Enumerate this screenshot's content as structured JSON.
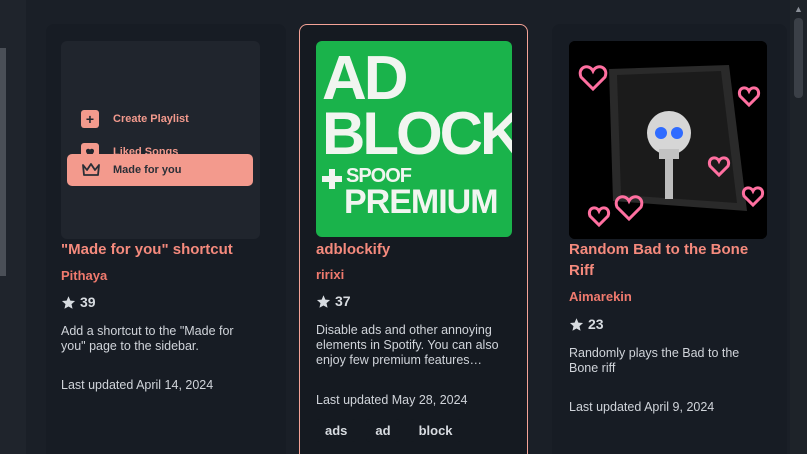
{
  "cards": [
    {
      "title": "\"Made for you\" shortcut",
      "author": "Pithaya",
      "stars": "39",
      "description": "Add a shortcut to the \"Made for you\" page to the sidebar.",
      "updated": "Last updated April 14, 2024",
      "preview": {
        "items": [
          "Create Playlist",
          "Liked Songs",
          "Made for you"
        ]
      }
    },
    {
      "title": "adblockify",
      "author": "ririxi",
      "stars": "37",
      "description": "Disable ads and other annoying elements in Spotify. You can also enjoy few premium features…",
      "updated": "Last updated May 28, 2024",
      "tags": [
        "ads",
        "ad",
        "block"
      ],
      "preview": {
        "line1": "AD",
        "line2": "BLOCK",
        "line3": "SPOOF",
        "line4": "PREMIUM"
      }
    },
    {
      "title": "Random Bad to the Bone Riff",
      "author": "Aimarekin",
      "stars": "23",
      "description": "Randomly plays the Bad to the Bone riff",
      "updated": "Last updated April 9, 2024"
    }
  ],
  "colors": {
    "accent": "#f58a7d",
    "background": "#1a1f27",
    "card": "#171c24",
    "adblock_green": "#1ab34b"
  },
  "icons": [
    "star-icon",
    "plus-icon",
    "heart-icon",
    "crown-icon",
    "scroll-up-icon"
  ]
}
